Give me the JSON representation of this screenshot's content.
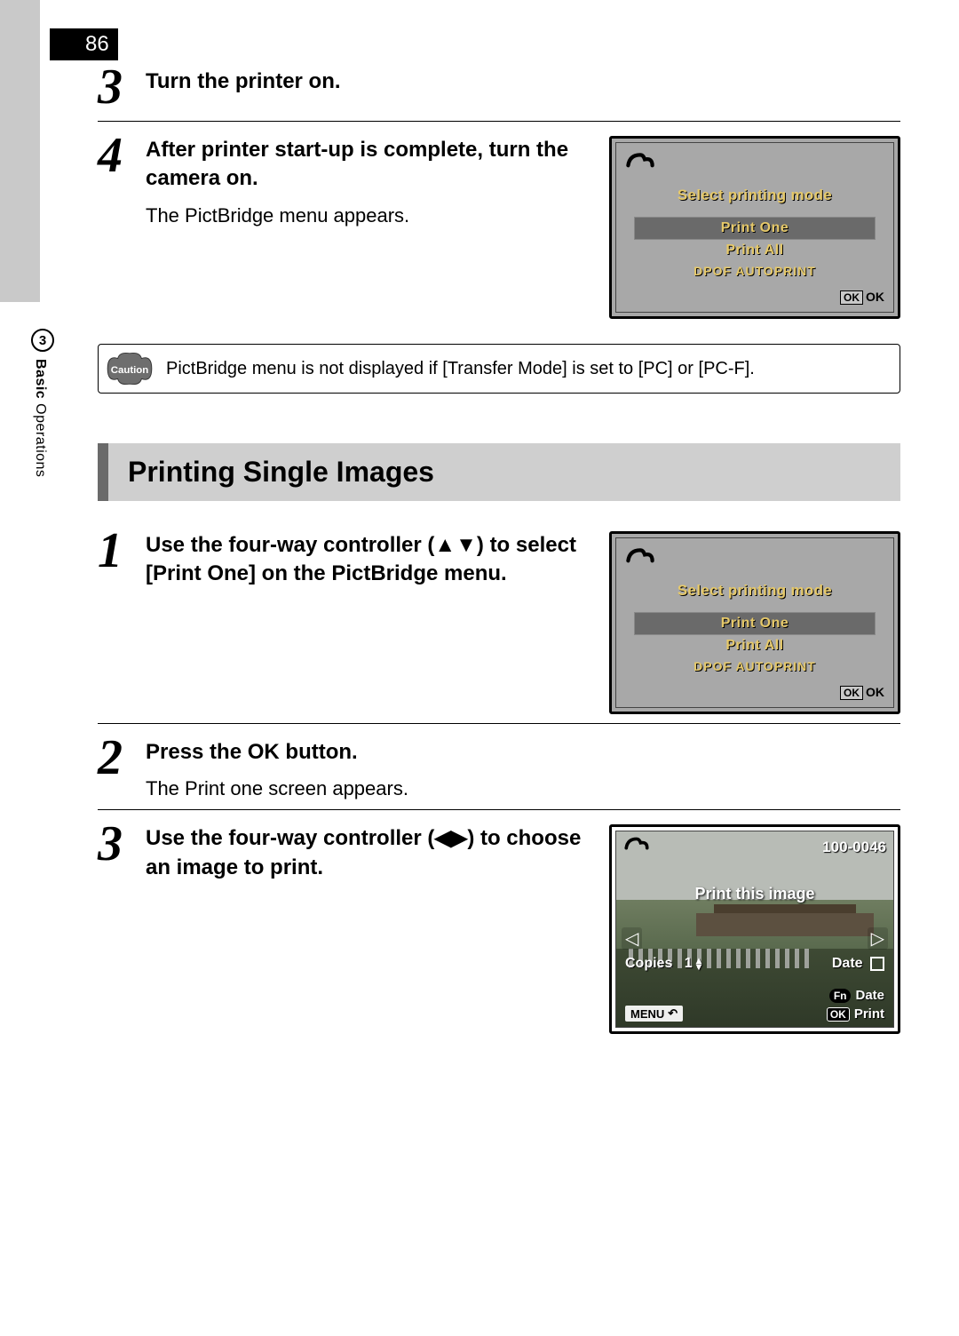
{
  "page_number": "86",
  "side": {
    "chapter_num": "3",
    "chapter_title_bold": "Basic",
    "chapter_title_rest": " Operations"
  },
  "section_a": {
    "steps": [
      {
        "num": "3",
        "title": "Turn the printer on."
      },
      {
        "num": "4",
        "title": "After printer start-up is complete, turn the camera on.",
        "desc": "The PictBridge menu appears."
      }
    ]
  },
  "lcd1": {
    "title": "Select printing mode",
    "items": [
      "Print One",
      "Print All",
      "DPOF AUTOPRINT"
    ],
    "selected_index": 0,
    "ok_box": "OK",
    "ok_label": "OK"
  },
  "caution": {
    "badge": "Caution",
    "text": "PictBridge menu is not displayed if [Transfer Mode] is set to [PC] or [PC-F]."
  },
  "section_heading": "Printing Single Images",
  "section_b": {
    "steps": [
      {
        "num": "1",
        "title_pre": "Use the four-way controller (",
        "title_arrows": "▲▼",
        "title_post": ") to select [Print One] on the PictBridge menu."
      },
      {
        "num": "2",
        "title_pre": "Press the ",
        "title_ok": "OK",
        "title_post": " button.",
        "desc": "The Print one screen appears."
      },
      {
        "num": "3",
        "title_pre": "Use the four-way controller (",
        "title_arrows": "◀▶",
        "title_post": ") to choose an image to print."
      }
    ]
  },
  "lcd2": {
    "title": "Select printing mode",
    "items": [
      "Print One",
      "Print All",
      "DPOF AUTOPRINT"
    ],
    "selected_index": 0,
    "ok_box": "OK",
    "ok_label": "OK"
  },
  "lcd3": {
    "file_no": "100-0046",
    "message": "Print this image",
    "left_arrow": "◁",
    "right_arrow": "▷",
    "copies_label": "Copies",
    "copies_val": "1",
    "copies_arrows": "▴▾",
    "date_label": "Date",
    "menu_label": "MENU",
    "menu_icon": "↶",
    "fn_pill": "Fn",
    "fn_label": "Date",
    "ok_pill": "OK",
    "ok_label": "Print"
  }
}
